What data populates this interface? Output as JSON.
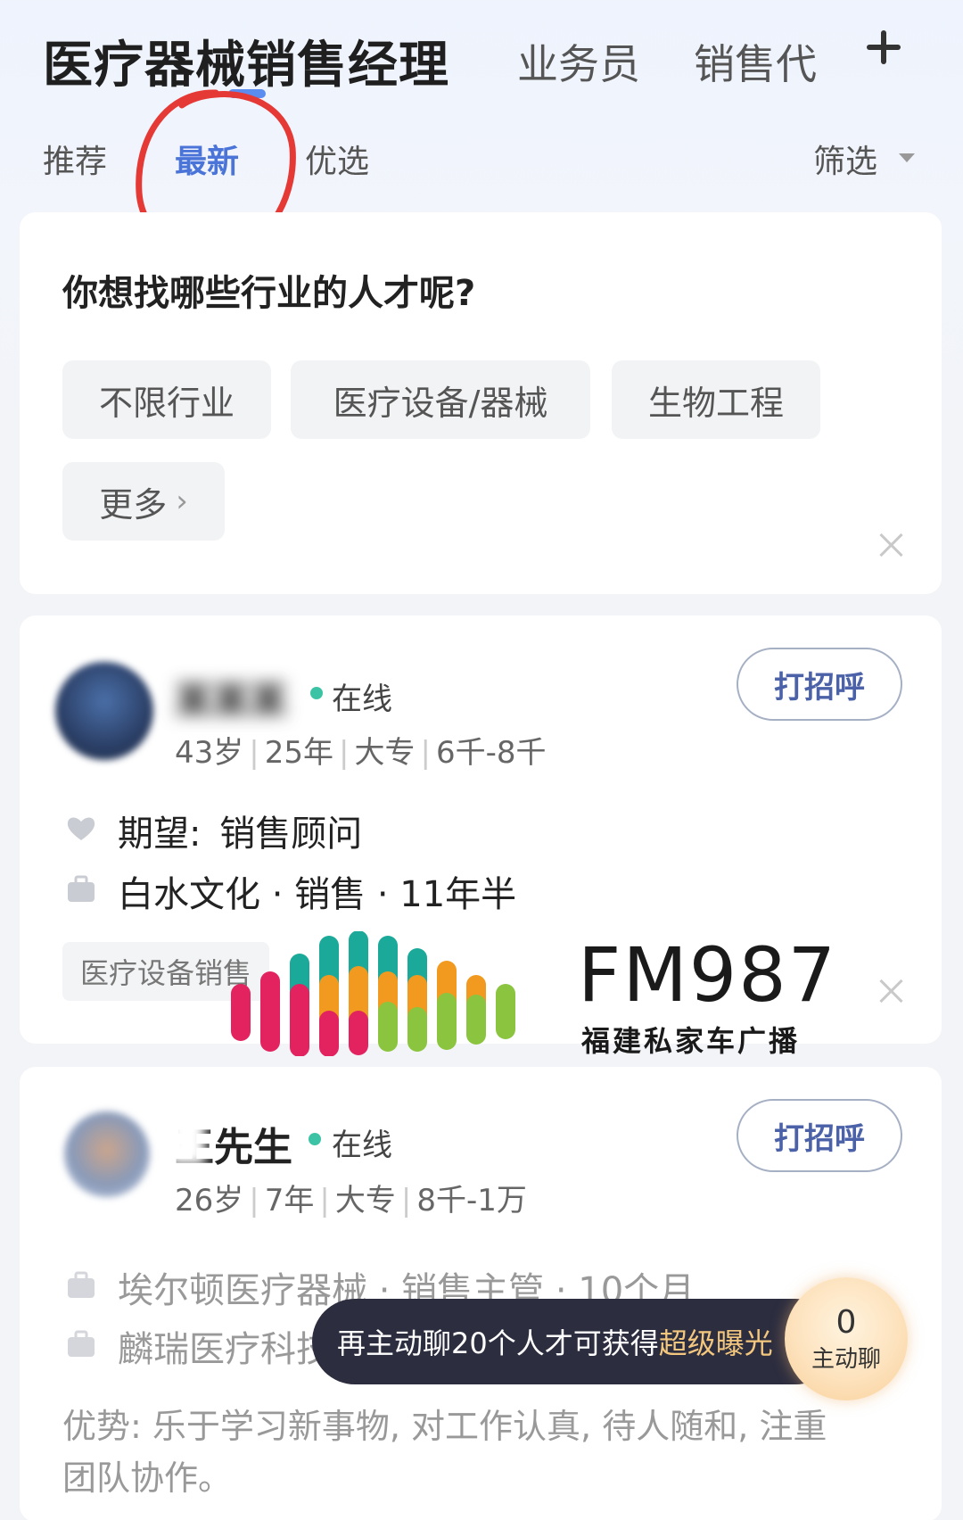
{
  "header": {
    "title": "医疗器械销售经理",
    "tabs": [
      "业务员",
      "销售代"
    ],
    "add_icon": "plus-icon"
  },
  "subtabs": {
    "items": [
      "推荐",
      "最新",
      "优选"
    ],
    "active": "最新",
    "filter_label": "筛选"
  },
  "industry_card": {
    "question": "你想找哪些行业的人才呢?",
    "chips": [
      "不限行业",
      "医疗设备/器械",
      "生物工程"
    ],
    "more_label": "更多",
    "close_icon": "close-icon"
  },
  "candidates": [
    {
      "name": "某某某",
      "status": "在线",
      "age": "43岁",
      "experience": "25年",
      "education": "大专",
      "salary": "6千-8千",
      "greet_label": "打招呼",
      "expect_label": "期望:",
      "expect_value": "销售顾问",
      "work": "白水文化 · 销售 · 11年半",
      "tag": "医疗设备销售"
    },
    {
      "name": "王先生",
      "status": "在线",
      "age": "26岁",
      "experience": "7年",
      "education": "大专",
      "salary": "8千-1万",
      "greet_label": "打招呼",
      "work1": "埃尔顿医疗器械 · 销售主管 · 10个月",
      "work2": "麟瑞医疗科技",
      "advantage": "优势: 乐于学习新事物, 对工作认真, 待人随和, 注重团队协作。"
    }
  ],
  "toast": {
    "text_prefix": "再主动聊20个人才可获得",
    "text_highlight": "超级曝光",
    "badge_count": "0",
    "badge_label": "主动聊"
  },
  "watermark": {
    "brand": "FM987",
    "subtitle": "福建私家车广播"
  },
  "colors": {
    "accent": "#4b74d8",
    "online": "#3cc3a5",
    "toast_bg": "#2c2d3f",
    "toast_highlight": "#f4c77e",
    "annotation": "#e53935"
  }
}
